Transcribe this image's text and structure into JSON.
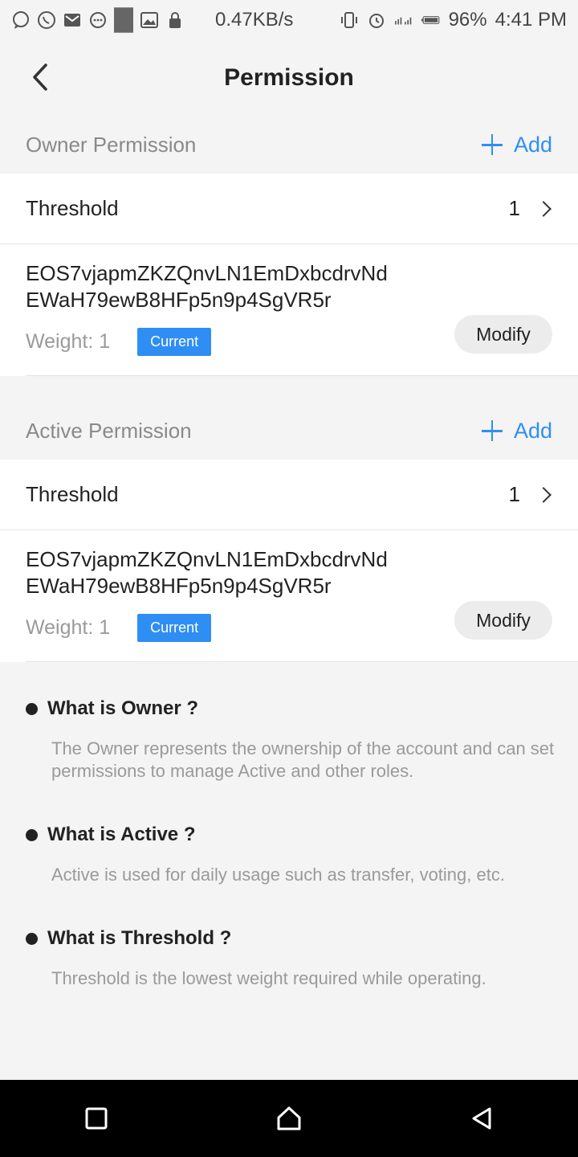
{
  "status_bar": {
    "net_speed": "0.47KB/s",
    "battery": "96%",
    "time": "4:41 PM",
    "icons": [
      "chat-icon",
      "whatsapp-icon",
      "mail-icon",
      "message-icon",
      "app-icon",
      "gallery-icon",
      "lock-icon",
      "vibrate-icon",
      "alarm-icon",
      "signal-icon",
      "battery-icon"
    ]
  },
  "header": {
    "title": "Permission"
  },
  "owner": {
    "section_title": "Owner Permission",
    "add_label": "Add",
    "threshold_label": "Threshold",
    "threshold_value": "1",
    "key_line1": "EOS7vjapmZKZQnvLN1EmDxbcdrvNd",
    "key_line2": "EWaH79ewB8HFp5n9p4SgVR5r",
    "weight": "Weight: 1",
    "badge": "Current",
    "modify_label": "Modify"
  },
  "active": {
    "section_title": "Active Permission",
    "add_label": "Add",
    "threshold_label": "Threshold",
    "threshold_value": "1",
    "key_line1": "EOS7vjapmZKZQnvLN1EmDxbcdrvNd",
    "key_line2": "EWaH79ewB8HFp5n9p4SgVR5r",
    "weight": "Weight: 1",
    "badge": "Current",
    "modify_label": "Modify"
  },
  "faq": [
    {
      "question": "What is Owner ?",
      "answer": "The Owner represents the ownership of the account and can set permissions to manage Active and other roles."
    },
    {
      "question": "What is Active ?",
      "answer": "Active is used for daily usage such as transfer, voting, etc."
    },
    {
      "question": "What is Threshold ?",
      "answer": "Threshold is the lowest weight required while operating."
    }
  ],
  "colors": {
    "accent": "#2f8ef4",
    "background": "#f4f4f4",
    "card": "#ffffff"
  }
}
